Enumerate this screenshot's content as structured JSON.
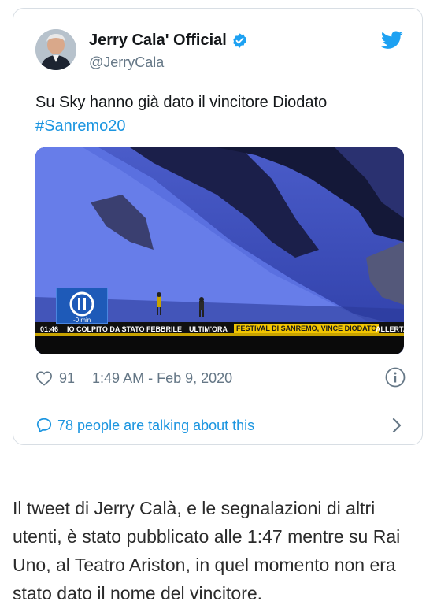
{
  "tweet": {
    "author_name": "Jerry Cala' Official",
    "author_handle": "@JerryCala",
    "text": "Su Sky hanno già dato il vincitore Diodato",
    "hashtag": "#Sanremo20",
    "like_count": "91",
    "timestamp": "1:49 AM - Feb 9, 2020",
    "conversation_label": "78 people are talking about this",
    "media": {
      "clock": "01:46",
      "ticker_segment_1": "IO COLPITO DA STATO FEBBRILE",
      "ticker_segment_2": "ULTIM'ORA",
      "ticker_highlight": "FESTIVAL DI SANREMO, VINCE DIODATO",
      "ticker_segment_3": "ALLERTA",
      "channel_minutes": "-0 min"
    },
    "colors": {
      "link": "#1b95e0",
      "text": "#14171a",
      "muted": "#657786"
    },
    "icons": [
      "verified-badge-icon",
      "twitter-bird-icon",
      "heart-icon",
      "info-icon",
      "speech-bubble-icon",
      "chevron-right-icon"
    ]
  },
  "article": {
    "paragraph": "Il tweet di Jerry Calà, e le segnalazioni di altri utenti, è stato pubblicato alle 1:47 mentre su Rai Uno, al Teatro Ariston, in quel momento non era stato dato il nome del vincitore."
  }
}
